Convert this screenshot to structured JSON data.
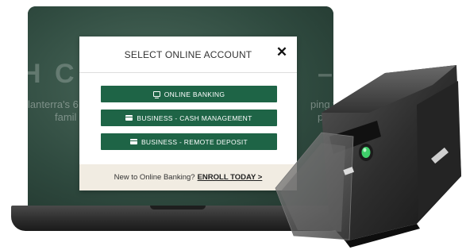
{
  "background_page": {
    "heading_left": "H C",
    "heading_right": "– 3",
    "line1_left": "lanterra's 6",
    "line1_right": "ping you",
    "line2_left": "famil",
    "line2_right": "pply."
  },
  "modal": {
    "title": "SELECT ONLINE ACCOUNT",
    "close_symbol": "✕",
    "buttons": [
      {
        "label": "ONLINE BANKING",
        "icon": "monitor-icon"
      },
      {
        "label": "BUSINESS - CASH MANAGEMENT",
        "icon": "wallet-icon"
      },
      {
        "label": "BUSINESS - REMOTE DEPOSIT",
        "icon": "wallet-icon"
      }
    ],
    "footer_text": "New to Online Banking?",
    "enroll_link": "ENROLL TODAY >"
  },
  "colors": {
    "button_green": "#1e6446",
    "footer_bg": "#f1ece2",
    "screen_bg": "#2f4a3f"
  }
}
